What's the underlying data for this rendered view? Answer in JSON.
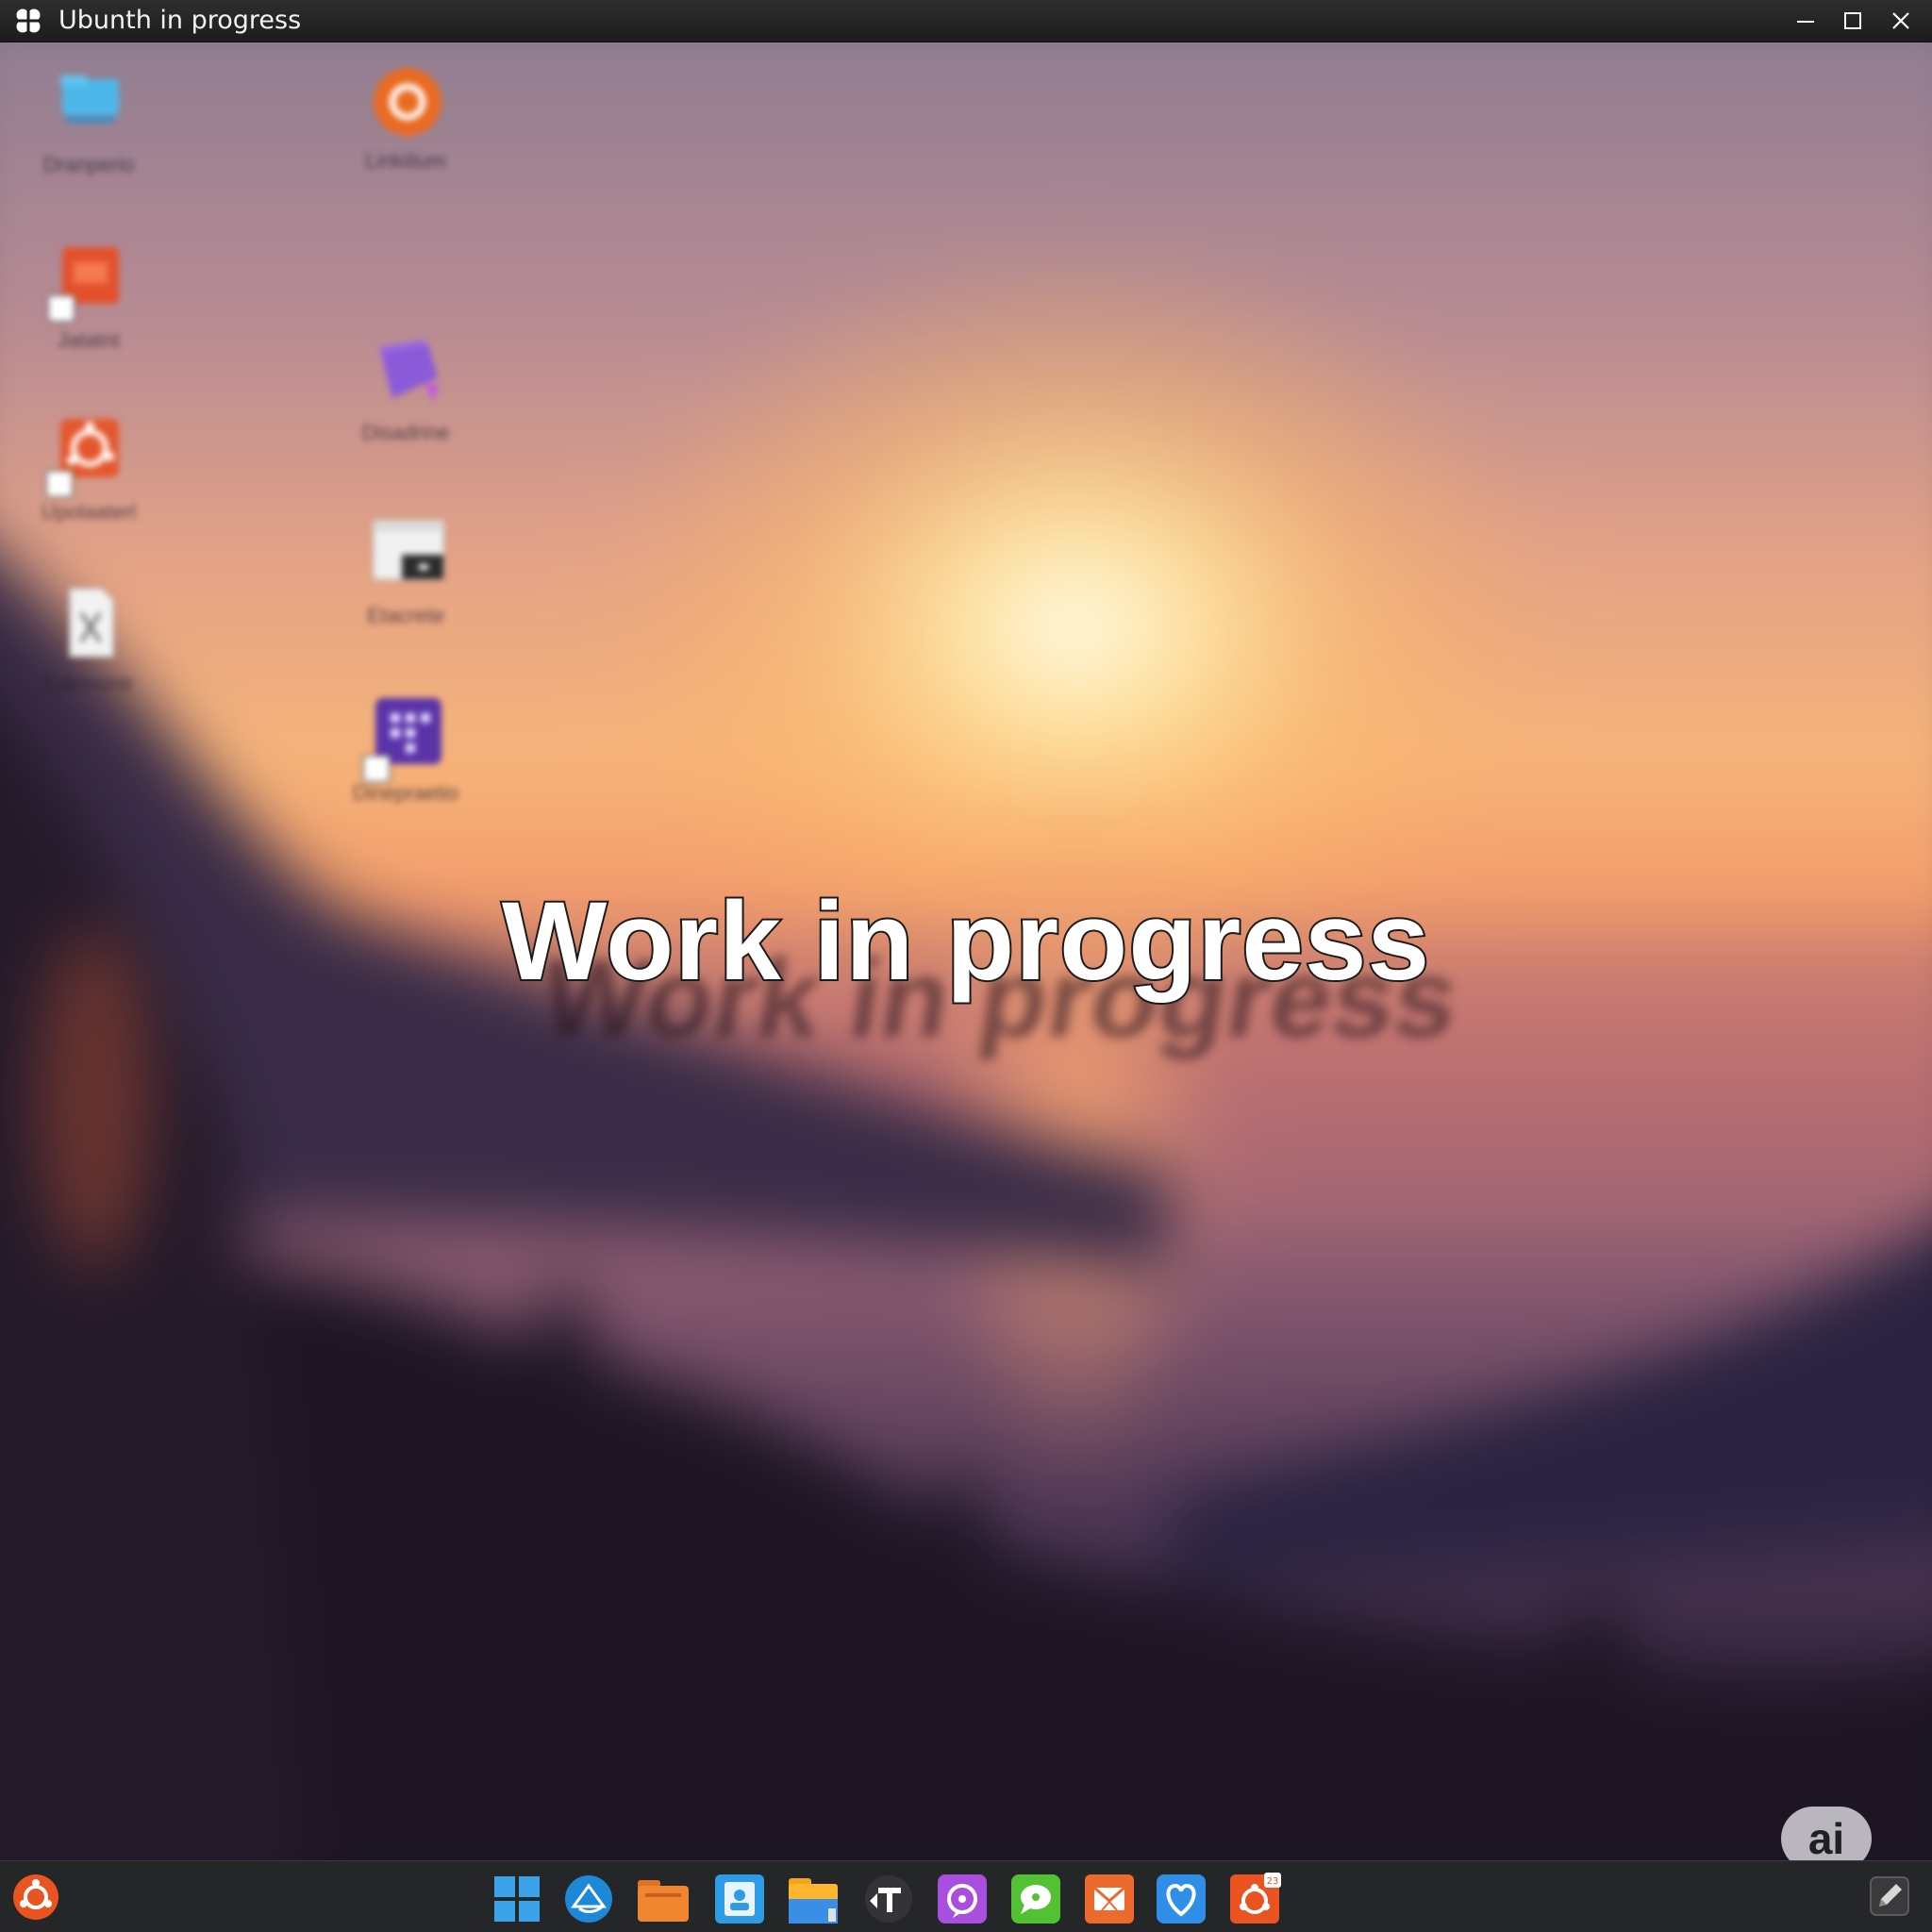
{
  "window": {
    "title": "Ubunth in progress"
  },
  "overlay": {
    "heading": "Work in progress",
    "badge_label": "ai"
  },
  "desktop_icons": [
    {
      "icon": "folder-computer-icon",
      "label": "Dranperio"
    },
    {
      "icon": "ubuntu-circle-icon",
      "label": "Linkilium"
    },
    {
      "icon": "presentation-icon",
      "label": "Jatatnt"
    },
    {
      "icon": "purple-folder-icon",
      "label": "Disadrine"
    },
    {
      "icon": "ubuntu-gear-icon",
      "label": "Upolaaterl"
    },
    {
      "icon": "terminal-window-icon",
      "label": "Etacrete"
    },
    {
      "icon": "document-icon",
      "label": "Edemontr"
    },
    {
      "icon": "purple-apps-icon",
      "label": "Dinepraetio"
    }
  ],
  "taskbar": {
    "apps": [
      "windows-grid-icon",
      "browser-icon",
      "orange-folder-icon",
      "contacts-icon",
      "file-manager-icon",
      "typography-icon",
      "purple-chat-icon",
      "green-message-icon",
      "orange-mail-icon",
      "heart-icon",
      "ubuntu-software-icon"
    ],
    "notification_count": "23"
  },
  "colors": {
    "accent": "#e95420",
    "taskbar": "#252628",
    "titlebar": "#232323"
  }
}
